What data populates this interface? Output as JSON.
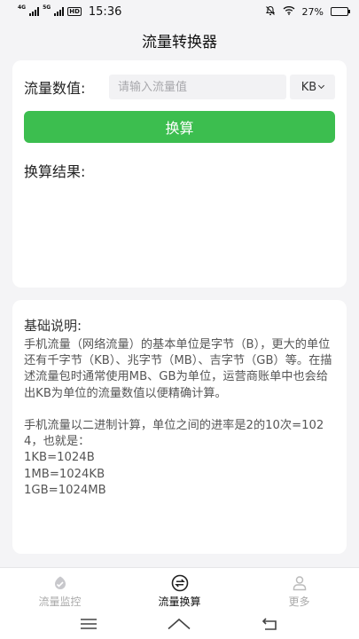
{
  "status_bar": {
    "network_a": "4G",
    "network_b": "5G",
    "hd_badge": "HD",
    "time": "15:36",
    "battery_text": "27%",
    "battery_level": 0.27
  },
  "header": {
    "title": "流量转换器"
  },
  "converter": {
    "input_label": "流量数值:",
    "input_value": "",
    "input_placeholder": "请输入流量值",
    "unit_selected": "KB",
    "convert_button": "换算",
    "result_label": "换算结果:"
  },
  "info": {
    "title": "基础说明:",
    "body": "手机流量（网络流量）的基本单位是字节（B），更大的单位还有千字节（KB）、兆字节（MB）、吉字节（GB）等。在描述流量包时通常使用MB、GB为单位，运营商账单中也会给出KB为单位的流量数值以便精确计算。\n\n手机流量以二进制计算，单位之间的进率是2的10次=1024，也就是：\n1KB=1024B\n1MB=1024KB\n1GB=1024MB"
  },
  "tabs": [
    {
      "label": "流量监控",
      "icon": "monitor-icon",
      "active": false
    },
    {
      "label": "流量换算",
      "icon": "convert-icon",
      "active": true
    },
    {
      "label": "更多",
      "icon": "person-icon",
      "active": false
    }
  ],
  "colors": {
    "accent": "#3cbe4f",
    "background": "#f4f4f6",
    "card": "#ffffff"
  }
}
